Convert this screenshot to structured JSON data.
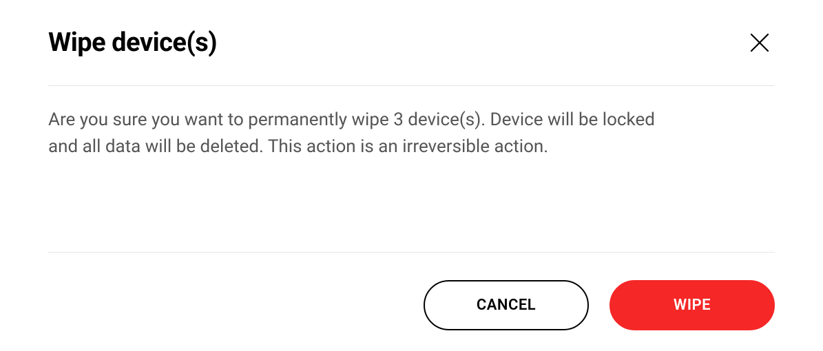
{
  "dialog": {
    "title": "Wipe device(s)",
    "message": "Are you sure you want to permanently wipe 3 device(s). Device will be locked and all data will be deleted. This action is an irreversible action.",
    "cancel_label": "CANCEL",
    "confirm_label": "WIPE"
  },
  "colors": {
    "danger": "#f52727",
    "text": "#555555",
    "title": "#000000",
    "divider": "#e5e5e5"
  }
}
